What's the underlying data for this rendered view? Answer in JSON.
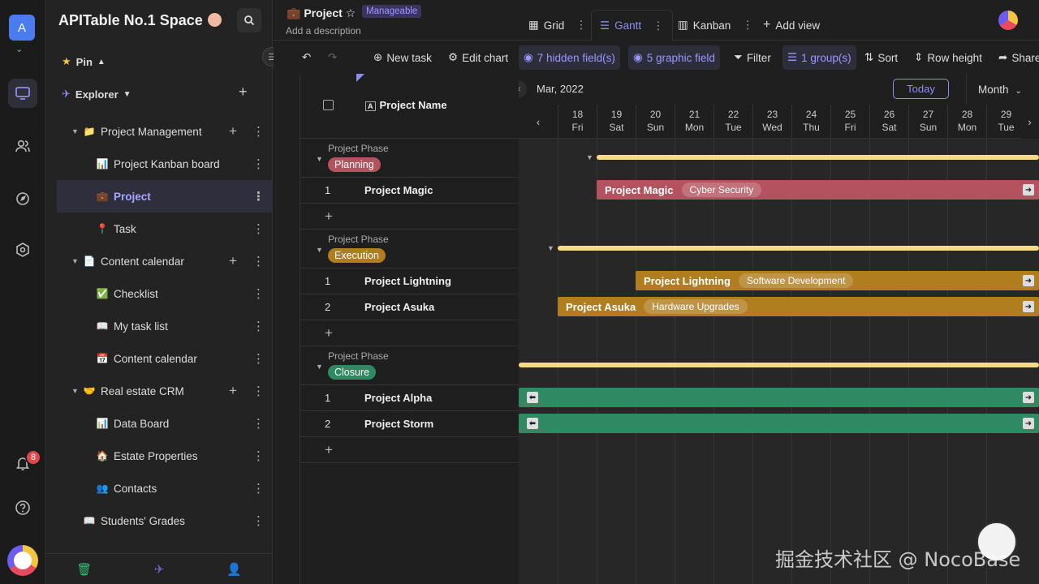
{
  "rail": {
    "avatar": "A",
    "badge": "8"
  },
  "side": {
    "space": "APITable No.1 Space",
    "pin": "Pin",
    "explorer": "Explorer",
    "tree": [
      {
        "label": "Project Management",
        "icon": "📁",
        "level": 0,
        "folder": true
      },
      {
        "label": "Project Kanban board",
        "icon": "📊",
        "level": 1
      },
      {
        "label": "Project",
        "icon": "💼",
        "level": 1,
        "selected": true
      },
      {
        "label": "Task",
        "icon": "📍",
        "level": 1
      },
      {
        "label": "Content calendar",
        "icon": "📄",
        "level": 0,
        "folder": true
      },
      {
        "label": "Checklist",
        "icon": "✅",
        "level": 1
      },
      {
        "label": "My task list",
        "icon": "📖",
        "level": 1
      },
      {
        "label": "Content calendar",
        "icon": "📅",
        "level": 1
      },
      {
        "label": "Real estate CRM",
        "icon": "🤝",
        "level": 0,
        "folder": true
      },
      {
        "label": "Data Board",
        "icon": "📊",
        "level": 1
      },
      {
        "label": "Estate Properties",
        "icon": "🏠",
        "level": 1
      },
      {
        "label": "Contacts",
        "icon": "👥",
        "level": 1
      },
      {
        "label": "Students' Grades",
        "icon": "📖",
        "level": 0
      }
    ]
  },
  "header": {
    "title": "Project",
    "badge": "Manageable",
    "desc": "Add a description",
    "tabs": {
      "grid": "Grid",
      "gantt": "Gantt",
      "kanban": "Kanban",
      "add": "Add view"
    }
  },
  "toolbar": {
    "new_task": "New task",
    "edit_chart": "Edit chart",
    "hidden": "7 hidden field(s)",
    "graphic": "5 graphic field",
    "filter": "Filter",
    "group": "1 group(s)",
    "sort": "Sort",
    "row_height": "Row height",
    "share": "Share"
  },
  "grid": {
    "col": "Project Name",
    "group_label": "Project Phase",
    "groups": [
      {
        "tag": "Planning",
        "color": "#b4535f",
        "rows": [
          "Project Magic"
        ]
      },
      {
        "tag": "Execution",
        "color": "#b07d1f",
        "rows": [
          "Project Lightning",
          "Project Asuka"
        ]
      },
      {
        "tag": "Closure",
        "color": "#2f8a63",
        "rows": [
          "Project Alpha",
          "Project Storm"
        ]
      }
    ],
    "nums": [
      "1",
      "1",
      "2",
      "1",
      "2"
    ]
  },
  "gantt": {
    "month": "Mar, 2022",
    "today": "Today",
    "unit": "Month",
    "days": [
      {
        "d": "18",
        "w": "Fri"
      },
      {
        "d": "19",
        "w": "Sat"
      },
      {
        "d": "20",
        "w": "Sun"
      },
      {
        "d": "21",
        "w": "Mon"
      },
      {
        "d": "22",
        "w": "Tue"
      },
      {
        "d": "23",
        "w": "Wed"
      },
      {
        "d": "24",
        "w": "Thu"
      },
      {
        "d": "25",
        "w": "Fri"
      },
      {
        "d": "26",
        "w": "Sat"
      },
      {
        "d": "27",
        "w": "Sun"
      },
      {
        "d": "28",
        "w": "Mon"
      },
      {
        "d": "29",
        "w": "Tue"
      }
    ],
    "bars": {
      "magic": {
        "name": "Project Magic",
        "tag": "Cyber Security"
      },
      "lightning": {
        "name": "Project Lightning",
        "tag": "Software Development"
      },
      "asuka": {
        "name": "Project Asuka",
        "tag": "Hardware Upgrades"
      }
    }
  },
  "watermark": "掘金技术社区 @ NocoBase"
}
